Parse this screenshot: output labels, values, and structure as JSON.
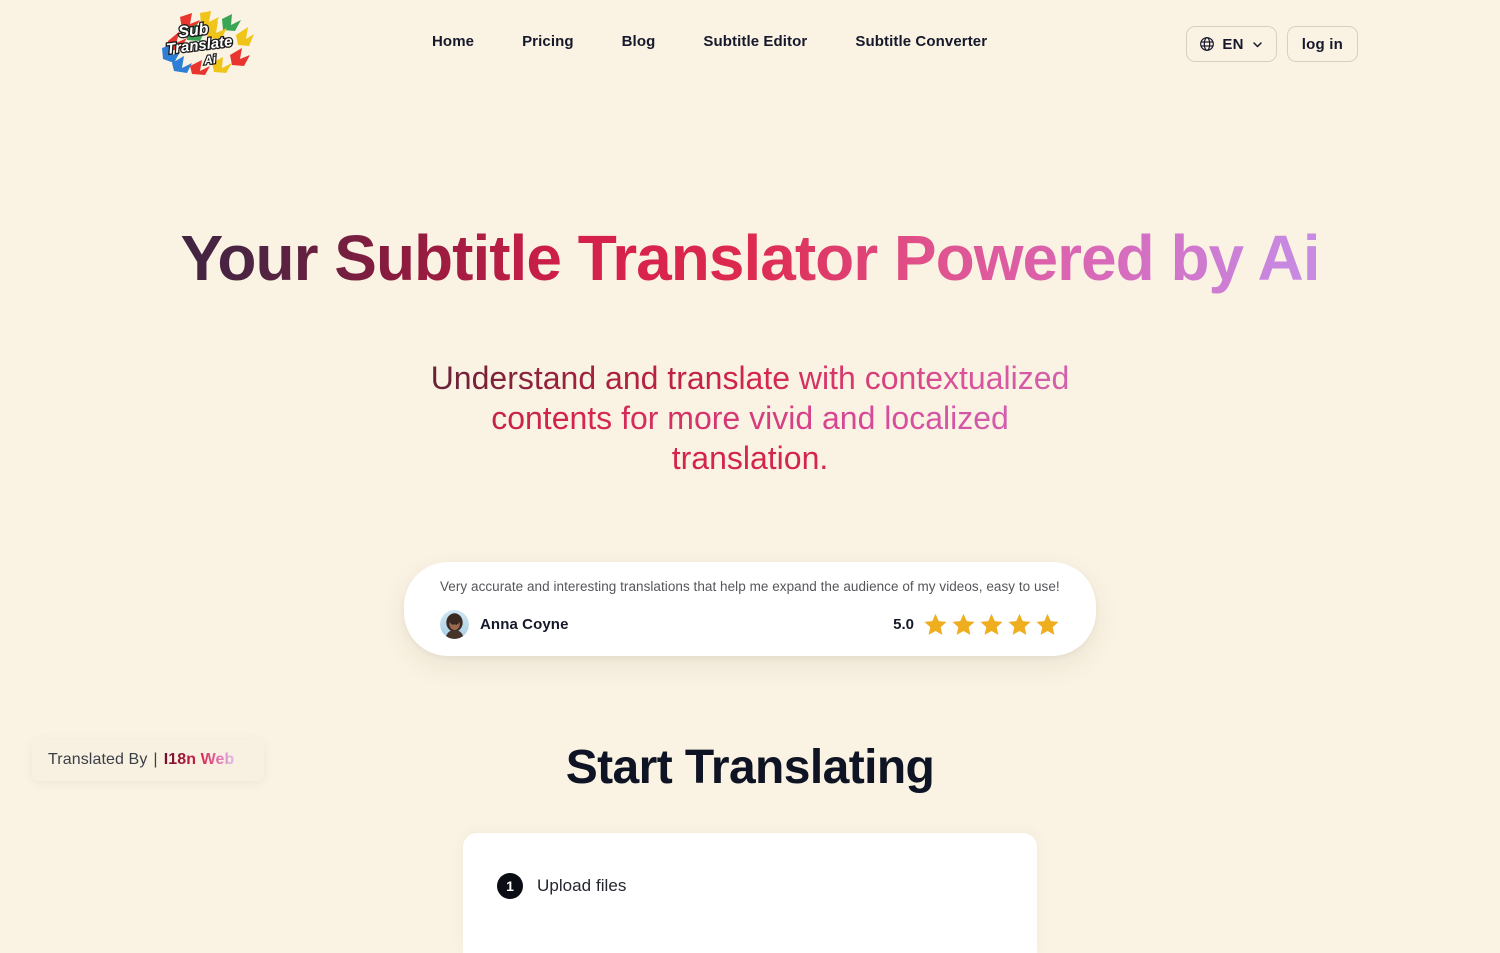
{
  "header": {
    "logo_alt": "Sub Translate Ai",
    "nav": [
      {
        "label": "Home"
      },
      {
        "label": "Pricing"
      },
      {
        "label": "Blog"
      },
      {
        "label": "Subtitle Editor"
      },
      {
        "label": "Subtitle Converter"
      }
    ],
    "language": {
      "value": "EN",
      "icon": "globe-icon",
      "chevron": "chevron-down-icon"
    },
    "login_label": "log in"
  },
  "hero": {
    "title": "Your Subtitle Translator Powered by Ai",
    "subtitle_lines": [
      "Understand and translate with contextualized",
      "contents for more vivid and localized",
      "translation."
    ]
  },
  "testimonial": {
    "quote": "Very accurate and interesting translations that help me expand the audience of my videos, easy to use!",
    "author": "Anna Coyne",
    "score": "5.0",
    "stars": 5
  },
  "translated_by": {
    "prefix": "Translated By",
    "separator": "|",
    "brand": "I18n Web"
  },
  "start": {
    "title": "Start Translating",
    "steps": [
      {
        "number": "1",
        "label": "Upload files"
      }
    ]
  },
  "colors": {
    "background": "#faf3e3",
    "ink": "#16182b",
    "crimson": "#d4244b",
    "lavender": "#c9a5f2",
    "star": "#eeae1e",
    "card": "#ffffff"
  }
}
